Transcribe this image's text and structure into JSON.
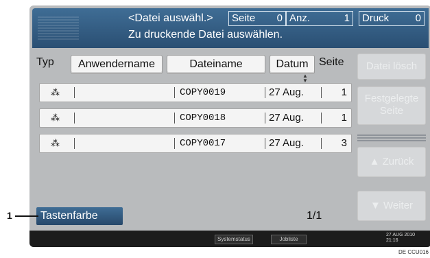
{
  "header": {
    "title": "<Datei auswähl.>",
    "subtitle": "Zu druckende Datei auswählen.",
    "seite_label": "Seite",
    "seite_value": "0",
    "anz_label": "Anz.",
    "anz_value": "1",
    "druck_label": "Druck",
    "druck_value": "0"
  },
  "columns": {
    "typ": "Typ",
    "user": "Anwendername",
    "file": "Dateiname",
    "date": "Datum",
    "pages": "Seite"
  },
  "files": [
    {
      "type_icon": "⁂",
      "user": "",
      "name": "COPY0019",
      "date": "27 Aug.",
      "pages": "1"
    },
    {
      "type_icon": "⁂",
      "user": "",
      "name": "COPY0018",
      "date": "27 Aug.",
      "pages": "1"
    },
    {
      "type_icon": "⁂",
      "user": "",
      "name": "COPY0017",
      "date": "27 Aug.",
      "pages": "3"
    }
  ],
  "side": {
    "delete": "Datei lösch",
    "fixed_page": "Festgelegte Seite",
    "back": "▲ Zurück",
    "next": "▼ Weiter"
  },
  "tasten": "Tastenfarbe",
  "page_indicator": "1/1",
  "statusbar": {
    "btn1": "Systemstatus",
    "btn2": "Jobliste",
    "datetime_line1": "27 AUG  2010",
    "datetime_line2": "21:16"
  },
  "callout": "1",
  "footer_code": "DE CCU016"
}
